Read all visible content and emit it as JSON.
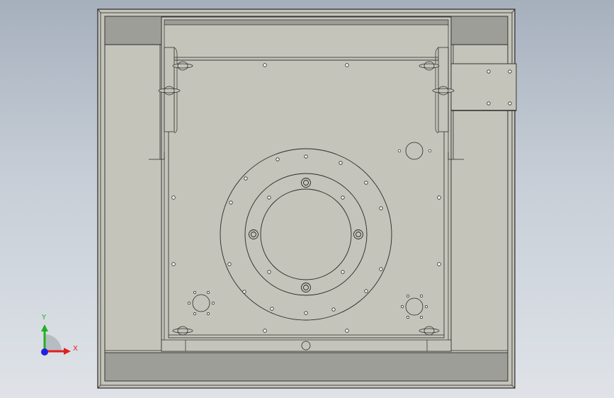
{
  "view": {
    "background_top": "#a6b0bd",
    "background_bottom": "#dfe3e8",
    "part_face_color": "#c4c4ba",
    "part_dark_color": "#9d9e98",
    "edge_color": "#2a2a2a"
  },
  "triad": {
    "x_label": "X",
    "y_label": "Y",
    "x_color": "#e02020",
    "y_color": "#20b020",
    "z_color": "#2020e0"
  }
}
